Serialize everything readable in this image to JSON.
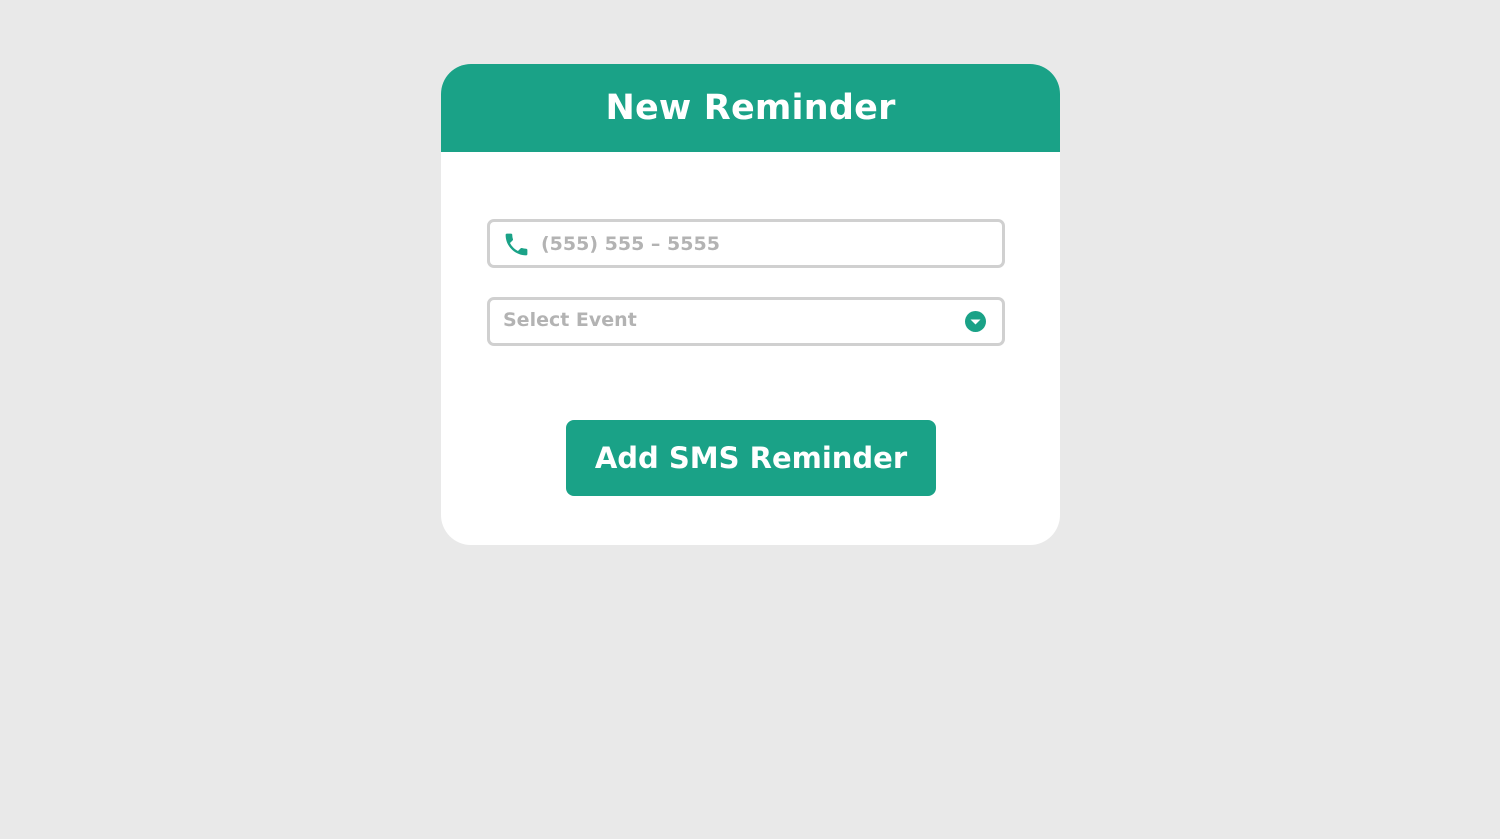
{
  "colors": {
    "accent": "#1aa287",
    "background": "#e9e9e9",
    "card": "#ffffff",
    "placeholder": "#b3b3b3",
    "field_border": "#d0d0d0"
  },
  "card": {
    "title": "New Reminder"
  },
  "phone": {
    "icon": "phone-icon",
    "placeholder": "(555) 555 – 5555",
    "value": ""
  },
  "event_select": {
    "selected": "Select Event",
    "icon": "dropdown-circle-icon"
  },
  "submit": {
    "label": "Add SMS Reminder"
  }
}
